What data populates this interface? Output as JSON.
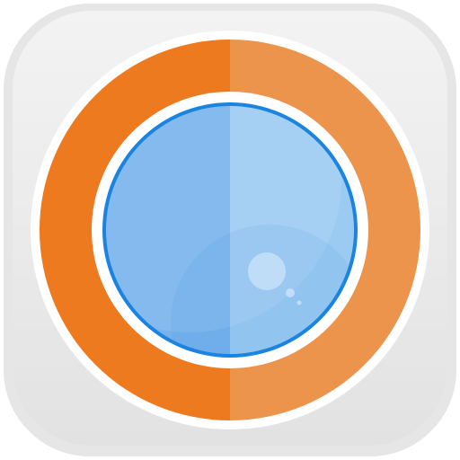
{
  "icon": {
    "name": "camera-lens-app-icon",
    "glyph": "lens",
    "colors": {
      "tile_outer": "#e6e6e6",
      "tile_inner": "#ededed",
      "tile_highlight": "#f6f6f6",
      "ring_left": "#ee7a1f",
      "ring_right": "#ec934c",
      "separator": "#ffffff",
      "lens_outline": "#1a84e0",
      "lens_left": "#76b3ec",
      "lens_right": "#9ccbf2",
      "lens_glint": "#c7e0f8"
    }
  }
}
